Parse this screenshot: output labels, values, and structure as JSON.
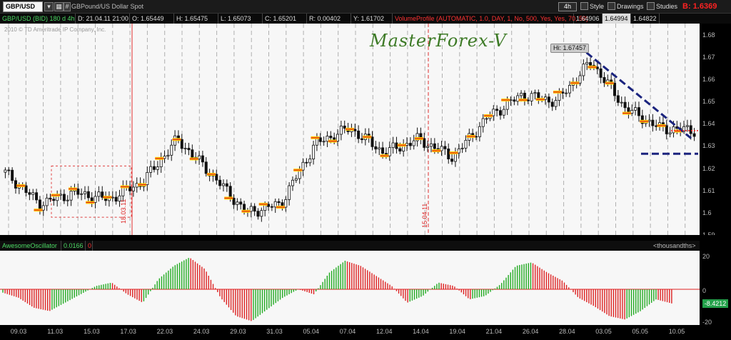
{
  "toolbar": {
    "symbol": "GBP/USD",
    "symbol_dropdown_icon": "chevron-down-icon",
    "description": "GBPound/US Dollar Spot",
    "timeframe": "4h",
    "style_label": "Style",
    "drawings_label": "Drawings",
    "studies_label": "Studies",
    "bid_value": "B: 1.6369"
  },
  "price_header": {
    "instrument": "GBP/USD (BID) 180 d 4h",
    "date": "D: 21.04.11 21:00",
    "open": "O: 1.65449",
    "high": "H: 1.65475",
    "low": "L: 1.65073",
    "close": "C: 1.65201",
    "range": "R: 0.00402",
    "yval": "Y: 1.61702",
    "volume_profile": "VolumeProfile (AUTOMATIC, 1.0, DAY, 1, No, 500, Yes, Yes, 70, 50)",
    "vp_val1": "1.64906",
    "vp_val2": "1.64994",
    "vp_val3": "1.64822"
  },
  "main": {
    "copyright": "2010 © TD Ameritrade IP Company, Inc.",
    "brand": "MasterForex-V",
    "hi_label": "Hi: 1.67457",
    "vline1_label": "18.03.11",
    "vline2_label": "15.04.11"
  },
  "price_axis": [
    "1.68",
    "1.67",
    "1.66",
    "1.65",
    "1.64",
    "1.63",
    "1.62",
    "1.61",
    "1.6",
    "1.59"
  ],
  "oscillator": {
    "name": "AwesomeOscillator",
    "value": "0.0166",
    "zero_label": "0",
    "units": "<thousandths>",
    "axis_top": "20",
    "axis_zero": "0",
    "axis_bottom": "-20",
    "current_value": "-8.4212"
  },
  "date_axis": [
    "09.03",
    "11.03",
    "15.03",
    "17.03",
    "22.03",
    "24.03",
    "29.03",
    "31.03",
    "05.04",
    "07.04",
    "12.04",
    "14.04",
    "19.04",
    "21.04",
    "26.04",
    "28.04",
    "03.05",
    "05.05",
    "10.05"
  ],
  "colors": {
    "bull": "#22aa22",
    "bear": "#dd2222",
    "marker": "#ffcc00",
    "trend": "#1a237e",
    "bid": "#ff2222",
    "brand": "#3d7a26"
  },
  "chart_data": {
    "type": "candlestick",
    "series": [
      {
        "name": "GBP/USD",
        "x": [
          "09.03",
          "11.03",
          "15.03",
          "17.03",
          "18.03",
          "22.03",
          "24.03",
          "29.03",
          "31.03",
          "05.04",
          "07.04",
          "12.04",
          "14.04",
          "15.04",
          "19.04",
          "21.04",
          "26.04",
          "28.04",
          "03.05",
          "05.05",
          "10.05"
        ],
        "values": [
          1.618,
          1.604,
          1.609,
          1.606,
          1.614,
          1.633,
          1.617,
          1.6,
          1.604,
          1.631,
          1.638,
          1.627,
          1.633,
          1.625,
          1.643,
          1.653,
          1.65,
          1.668,
          1.647,
          1.638,
          1.637
        ]
      }
    ],
    "ylim": [
      1.59,
      1.685
    ],
    "annotations": [
      "Hi: 1.67457"
    ]
  },
  "oscillator_data": {
    "type": "bar",
    "values": [
      -2,
      -5,
      -11,
      -13,
      -8,
      -3,
      2,
      4,
      -3,
      -8,
      6,
      14,
      19,
      12,
      -5,
      -16,
      -19,
      -12,
      -5,
      0,
      -3,
      10,
      17,
      14,
      8,
      2,
      -8,
      -4,
      4,
      2,
      -6,
      -4,
      3,
      14,
      16,
      10,
      5,
      -5,
      -10,
      -16,
      -18,
      -13,
      -6,
      -8.4212
    ],
    "ylim": [
      -20,
      20
    ]
  }
}
